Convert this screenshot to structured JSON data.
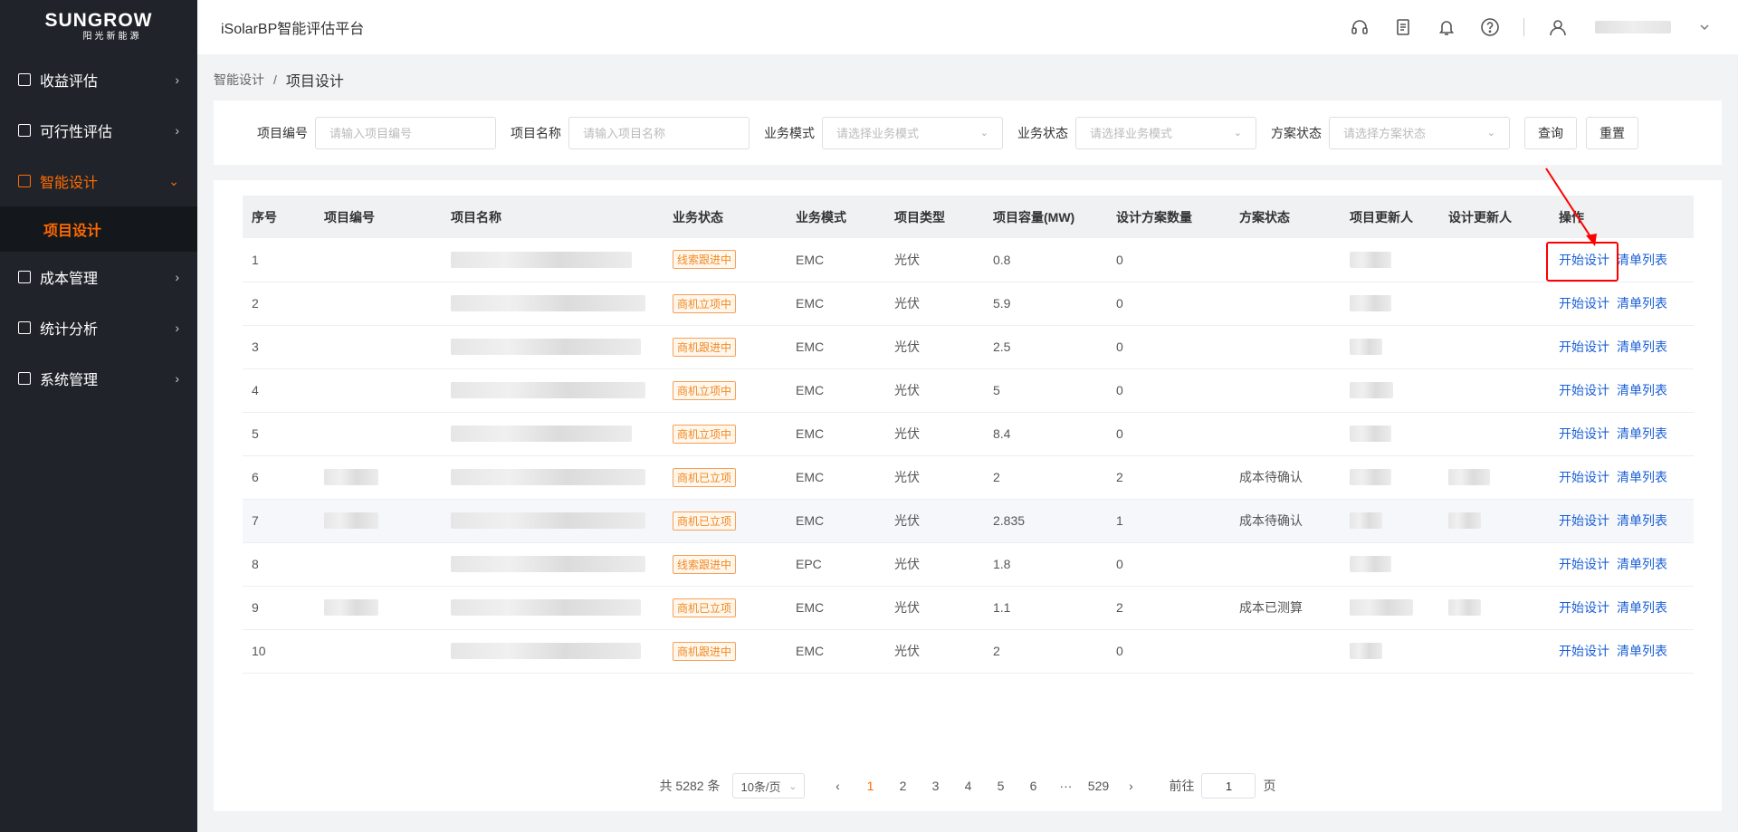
{
  "app": {
    "logo_main": "SUNGROW",
    "logo_sub": "阳光新能源",
    "title": "iSolarBP智能评估平台"
  },
  "sidebar": {
    "items": [
      {
        "label": "收益评估",
        "arrow": "›"
      },
      {
        "label": "可行性评估",
        "arrow": "›"
      },
      {
        "label": "智能设计",
        "arrow": "⌄"
      },
      {
        "label": "成本管理",
        "arrow": "›"
      },
      {
        "label": "统计分析",
        "arrow": "›"
      },
      {
        "label": "系统管理",
        "arrow": "›"
      }
    ],
    "sub_active": "项目设计"
  },
  "breadcrumb": {
    "parent": "智能设计",
    "sep": "/",
    "current": "项目设计"
  },
  "filter": {
    "project_no_label": "项目编号",
    "project_no_placeholder": "请输入项目编号",
    "project_name_label": "项目名称",
    "project_name_placeholder": "请输入项目名称",
    "biz_mode_label": "业务模式",
    "biz_mode_placeholder": "请选择业务模式",
    "biz_status_label": "业务状态",
    "biz_status_placeholder": "请选择业务模式",
    "plan_status_label": "方案状态",
    "plan_status_placeholder": "请选择方案状态",
    "query_label": "查询",
    "reset_label": "重置"
  },
  "table": {
    "headers": [
      "序号",
      "项目编号",
      "项目名称",
      "业务状态",
      "业务模式",
      "项目类型",
      "项目容量(MW)",
      "设计方案数量",
      "方案状态",
      "项目更新人",
      "设计更新人",
      "操作"
    ],
    "rows": [
      {
        "no": "1",
        "status": "线索跟进中",
        "mode": "EMC",
        "type": "光伏",
        "cap": "0.8",
        "count": "0",
        "plan": ""
      },
      {
        "no": "2",
        "status": "商机立项中",
        "mode": "EMC",
        "type": "光伏",
        "cap": "5.9",
        "count": "0",
        "plan": ""
      },
      {
        "no": "3",
        "status": "商机跟进中",
        "mode": "EMC",
        "type": "光伏",
        "cap": "2.5",
        "count": "0",
        "plan": ""
      },
      {
        "no": "4",
        "status": "商机立项中",
        "mode": "EMC",
        "type": "光伏",
        "cap": "5",
        "count": "0",
        "plan": ""
      },
      {
        "no": "5",
        "status": "商机立项中",
        "mode": "EMC",
        "type": "光伏",
        "cap": "8.4",
        "count": "0",
        "plan": ""
      },
      {
        "no": "6",
        "status": "商机已立项",
        "mode": "EMC",
        "type": "光伏",
        "cap": "2",
        "count": "2",
        "plan": "成本待确认"
      },
      {
        "no": "7",
        "status": "商机已立项",
        "mode": "EMC",
        "type": "光伏",
        "cap": "2.835",
        "count": "1",
        "plan": "成本待确认"
      },
      {
        "no": "8",
        "status": "线索跟进中",
        "mode": "EPC",
        "type": "光伏",
        "cap": "1.8",
        "count": "0",
        "plan": ""
      },
      {
        "no": "9",
        "status": "商机已立项",
        "mode": "EMC",
        "type": "光伏",
        "cap": "1.1",
        "count": "2",
        "plan": "成本已测算"
      },
      {
        "no": "10",
        "status": "商机跟进中",
        "mode": "EMC",
        "type": "光伏",
        "cap": "2",
        "count": "0",
        "plan": ""
      }
    ],
    "op_design": "开始设计",
    "op_list": "清单列表"
  },
  "pager": {
    "total": "共 5282 条",
    "size": "10条/页",
    "prev": "‹",
    "pages": [
      "1",
      "2",
      "3",
      "4",
      "5",
      "6",
      "···",
      "529"
    ],
    "next": "›",
    "goto_prefix": "前往",
    "goto_value": "1",
    "goto_suffix": "页"
  }
}
